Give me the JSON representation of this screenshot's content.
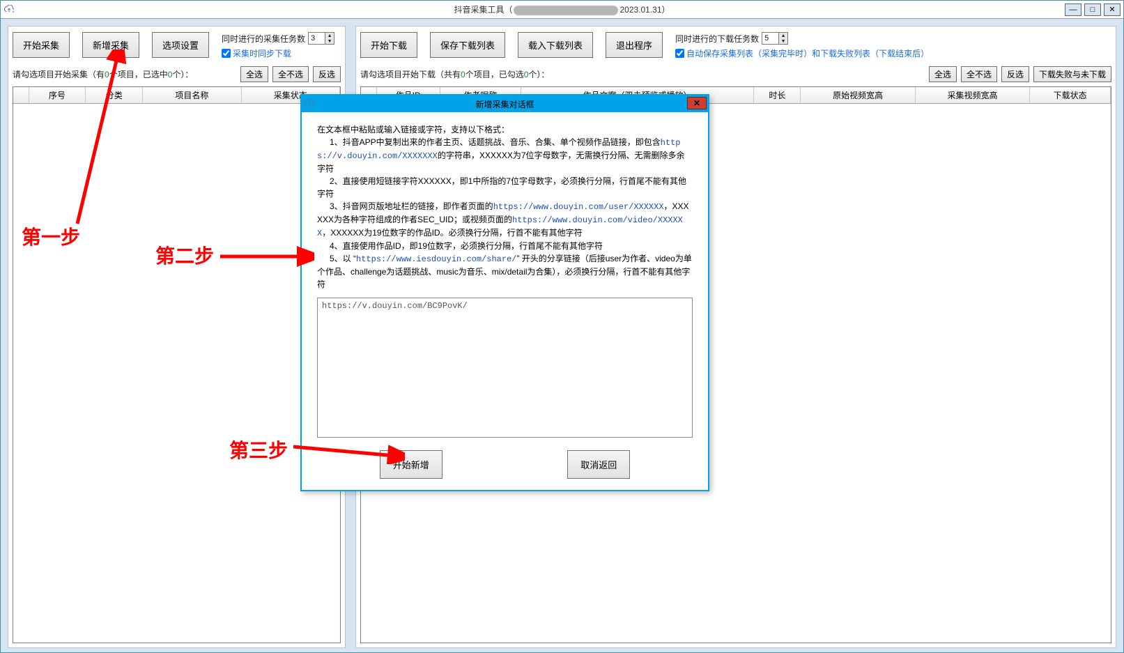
{
  "titlebar": {
    "title_prefix": "抖音采集工具（",
    "title_suffix": "2023.01.31）"
  },
  "win_buttons": {
    "min": "—",
    "max": "□",
    "close": "✕"
  },
  "left": {
    "buttons": {
      "start_collect": "开始采集",
      "add_collect": "新增采集",
      "options": "选项设置"
    },
    "spinner": {
      "label": "同时进行的采集任务数",
      "value": "3"
    },
    "checkbox": "采集时同步下载",
    "status_prefix": "请勾选项目开始采集（",
    "status_count1_prefix": "有",
    "status_count1": "0",
    "status_mid": "个项目，已选中",
    "status_count2": "0",
    "status_suffix": "个）：",
    "smallbtns": {
      "all": "全选",
      "none": "全不选",
      "inv": "反选"
    },
    "columns": [
      "",
      "序号",
      "分类",
      "项目名称",
      "采集状态"
    ]
  },
  "right": {
    "buttons": {
      "start_dl": "开始下载",
      "save_list": "保存下载列表",
      "load_list": "载入下载列表",
      "exit": "退出程序"
    },
    "spinner": {
      "label": "同时进行的下载任务数",
      "value": "5"
    },
    "checkbox": "自动保存采集列表（采集完毕时）和下载失败列表（下载结束后）",
    "status_prefix": "请勾选项目开始下载（共有",
    "status_count1": "0",
    "status_mid": "个项目，已勾选",
    "status_count2": "0",
    "status_suffix": "个）：",
    "smallbtns": {
      "all": "全选",
      "none": "全不选",
      "inv": "反选",
      "failed": "下载失败与未下载"
    },
    "columns": [
      "",
      "作品ID",
      "作者昵称",
      "作品文案（双击预览或播放）",
      "时长",
      "原始视频宽高",
      "采集视频宽高",
      "下载状态"
    ]
  },
  "dialog": {
    "title": "新增采集对话框",
    "intro": "在文本框中粘贴或输入链接或字符，支持以下格式：",
    "l1a": "1、抖音APP中复制出来的作者主页、话题挑战、音乐、合集、单个视频作品链接，即包含",
    "l1m": "https://v.douyin.com/XXXXXXX",
    "l1b": "的字符串，XXXXXX为7位字母数字，无需换行分隔、无需删除多余字符",
    "l2": "2、直接使用短链接字符XXXXXX，即1中所指的7位字母数字，必须换行分隔，行首尾不能有其他字符",
    "l3a": "3、抖音网页版地址栏的链接，即作者页面的",
    "l3m1": "https://www.douyin.com/user/XXXXXX",
    "l3b": "，XXXXXX为各种字符组成的作者SEC_UID；或视频页面的",
    "l3m2": "https://www.douyin.com/video/XXXXXX",
    "l3c": "，XXXXXX为19位数字的作品ID。必须换行分隔，行首不能有其他字符",
    "l4": "4、直接使用作品ID，即19位数字，必须换行分隔，行首尾不能有其他字符",
    "l5a": "5、以 “",
    "l5m": "https://www.iesdouyin.com/share/",
    "l5b": "” 开头的分享链接（后接user为作者、video为单个作品、challenge为话题挑战、music为音乐、mix/detail为合集），必须换行分隔，行首不能有其他字符",
    "textarea_value": "https://v.douyin.com/BC9PovK/",
    "btn_add": "开始新增",
    "btn_cancel": "取消返回"
  },
  "annotations": {
    "step1": "第一步",
    "step2": "第二步",
    "step3": "第三步"
  }
}
